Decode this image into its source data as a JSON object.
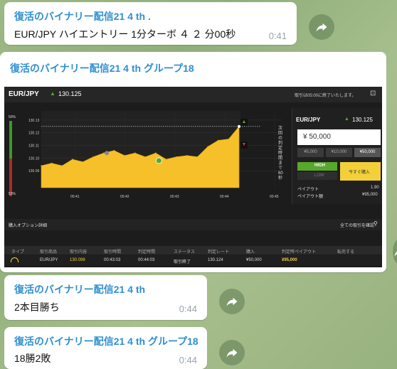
{
  "messages": [
    {
      "sender": "復活のバイナリー配信21 4 th .",
      "text": "EUR/JPY ハイエントリー 1分ターボ ４ ２ 分00秒",
      "time": "0:41"
    },
    {
      "sender": "復活のバイナリー配信21 4 th グループ18",
      "time": ""
    },
    {
      "sender": "復活のバイナリー配信21 4 th",
      "text": "2本目勝ち",
      "time": "0:44"
    },
    {
      "sender": "復活のバイナリー配信21 4 th グループ18",
      "text": "18勝2敗",
      "time": "0:44"
    }
  ],
  "trade_screenshot": {
    "pair": "EUR/JPY",
    "price": "130.125",
    "notice": "取引は05:00に終了いたします。",
    "panel_pair": "EUR/JPY",
    "panel_price": "130.125",
    "amount": "¥ 50,000",
    "amount_options": [
      "¥5,000",
      "¥10,000",
      "¥50,000"
    ],
    "high_label": "HIGH",
    "low_label": "LOW",
    "buy_label": "今すぐ購入",
    "payout_label": "ペイアウト",
    "payout_value": "1.90",
    "payout_amount_label": "ペイアウト額",
    "payout_amount_value": "¥95,000",
    "vertical_note": "次回の判定時間まで60秒",
    "pct_top": "50%",
    "pct_bottom": "50%",
    "y_ticks": [
      "130.13",
      "130.12",
      "130.11",
      "130.10",
      "130.09"
    ],
    "x_ticks": [
      "00:41",
      "00:42",
      "00:43",
      "00:44",
      "00:45"
    ],
    "options_title": "購入オプション詳細",
    "all_trades_label": "全ての取引を確認",
    "table_headers": [
      "タイプ",
      "取引商品",
      "取引内容",
      "取引時間",
      "判定時間",
      "ステータス",
      "判定レート",
      "購入",
      "判定時ペイアウト",
      "転売する"
    ],
    "table_row": [
      "",
      "EUR/JPY",
      "130.098",
      "00:43:03",
      "00:44:03",
      "取引終了",
      "130.124",
      "¥50,000",
      "¥95,000",
      ""
    ]
  },
  "chart_data": {
    "type": "area",
    "title": "",
    "xlabel": "",
    "ylabel": "",
    "x": [
      "00:41",
      "00:41:10",
      "00:41:20",
      "00:41:30",
      "00:41:40",
      "00:41:50",
      "00:42",
      "00:42:10",
      "00:42:20",
      "00:42:30",
      "00:42:40",
      "00:42:50",
      "00:43",
      "00:43:10",
      "00:43:20",
      "00:43:30",
      "00:43:40",
      "00:43:50",
      "00:44",
      "00:44:10"
    ],
    "series": [
      {
        "values": [
          130.094,
          130.096,
          130.094,
          130.099,
          130.097,
          130.101,
          130.104,
          130.106,
          130.102,
          130.104,
          130.101,
          130.104,
          130.099,
          130.101,
          130.102,
          130.101,
          130.109,
          130.114,
          130.115,
          130.125
        ]
      }
    ],
    "ylim": [
      130.08,
      130.135
    ],
    "entry_rate": 130.098,
    "entry_time": "00:43:03",
    "close_rate": 130.124
  },
  "colors": {
    "sender": "#2f8fd0",
    "area": "#f5c02a",
    "high": "#58a82a",
    "buy": "#f3d03a"
  }
}
